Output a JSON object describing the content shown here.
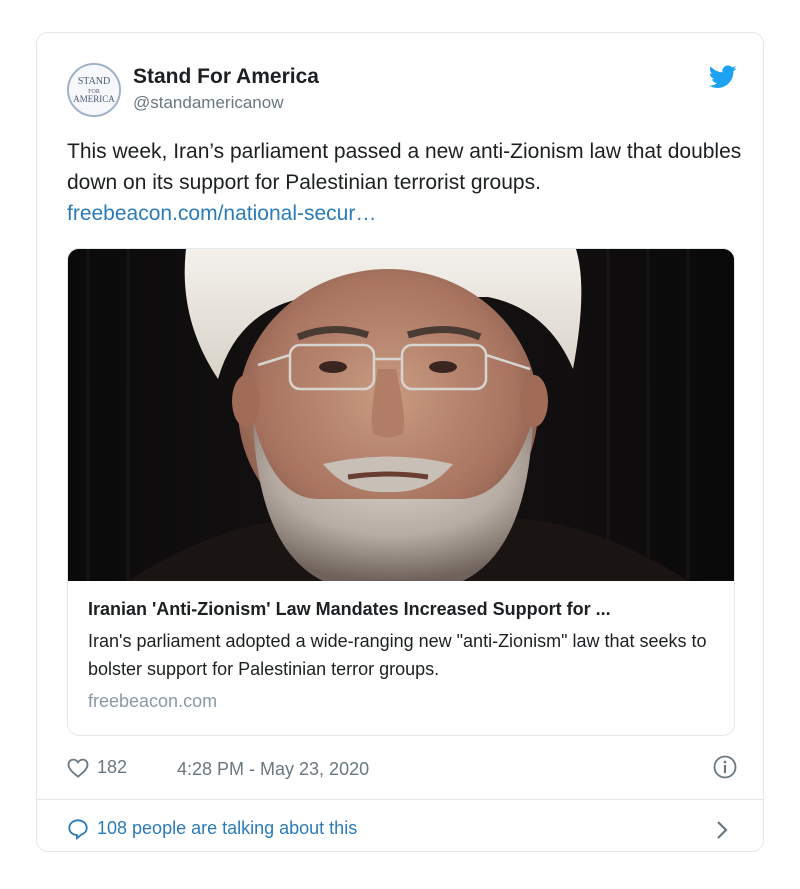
{
  "account": {
    "name": "Stand For America",
    "handle": "@standamericanow",
    "avatar_text_top": "STAND",
    "avatar_text_mid": "FOR",
    "avatar_text_bottom": "AMERICA"
  },
  "tweet": {
    "text": "This week, Iran’s parliament passed a new anti-Zionism law that doubles down on its support for Palestinian terrorist groups.",
    "link": "freebeacon.com/national-secur…"
  },
  "card": {
    "title": "Iranian 'Anti-Zionism' Law Mandates Increased Support for ...",
    "description": "Iran's parliament adopted a wide-ranging new \"anti-Zionism\" law that seeks to bolster support for Palestinian terror groups.",
    "domain": "freebeacon.com"
  },
  "meta": {
    "likes": "182",
    "timestamp": "4:28 PM - May 23, 2020"
  },
  "footer": {
    "talking": "108 people are talking about this"
  },
  "icons": {
    "bird": "twitter-bird-icon",
    "heart": "heart-icon",
    "info": "info-icon",
    "bubble": "reply-bubble-icon",
    "chevron": "chevron-right-icon"
  },
  "colors": {
    "link": "#2b7bb9",
    "bird": "#1da1f2",
    "muted": "#697882",
    "border": "#e1e8ed"
  }
}
